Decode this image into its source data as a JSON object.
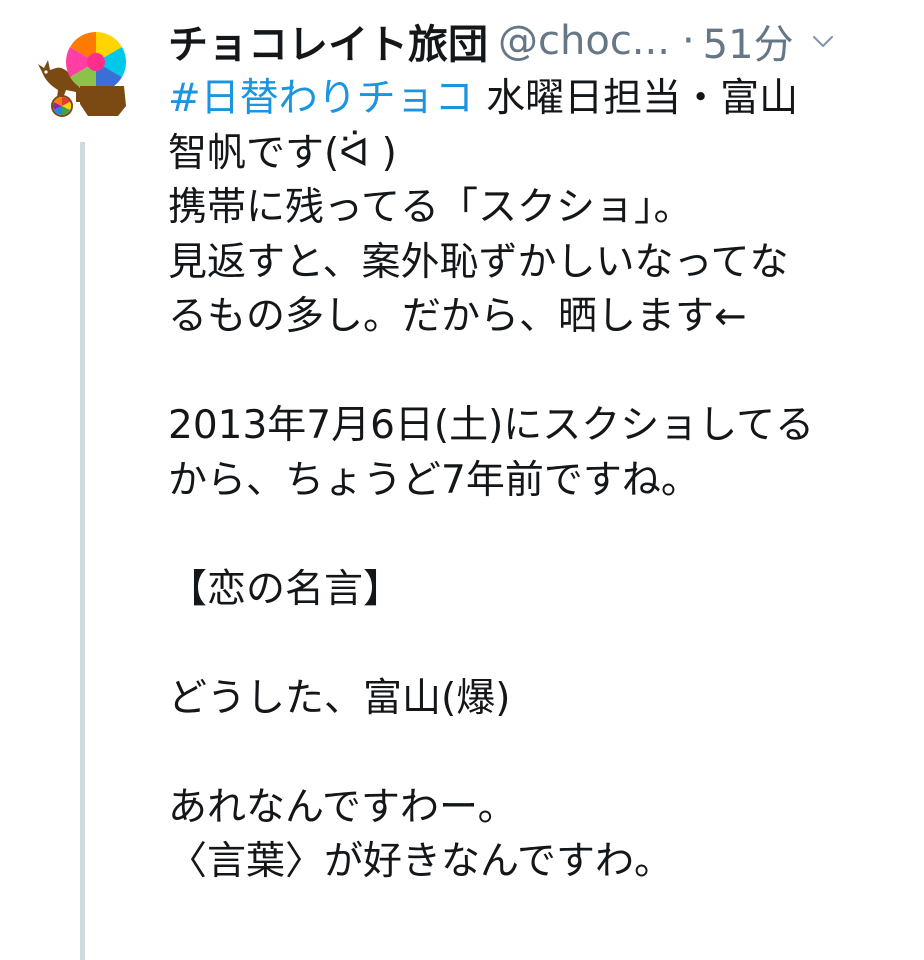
{
  "tweet": {
    "display_name": "チョコレイト旅団",
    "handle": "@choc...",
    "separator": "·",
    "time": "51分",
    "caret_icon": "chevron-down-icon",
    "avatar_icon": "chocolate-brigade-avatar-icon",
    "colors": {
      "hashtag": "#1b95e0",
      "meta_gray": "#657786",
      "thread_line": "#cfd9de",
      "text": "#14171a"
    },
    "body": {
      "hashtag": "#日替わりチョコ",
      "line1_rest": " 水曜日担当・富山",
      "line2": "智帆です(ᐛ )",
      "line3": "携帯に残ってる「スクショ」。",
      "line4": "見返すと、案外恥ずかしいなってな",
      "line5": "るもの多し。だから、晒します←",
      "line7": "2013年7月6日(土)にスクショしてる",
      "line8": "から、ちょうど7年前ですね。",
      "line10": "【恋の名言】",
      "line12": "どうした、富山(爆)",
      "line14": "あれなんですわー。",
      "line15": "〈言葉〉が好きなんですわ。"
    }
  }
}
